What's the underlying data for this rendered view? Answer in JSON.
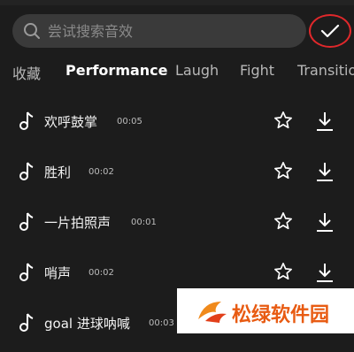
{
  "search": {
    "placeholder": "尝试搜索音效",
    "value": ""
  },
  "tabs": [
    {
      "label": "收藏",
      "active": false
    },
    {
      "label": "Performance",
      "active": true
    },
    {
      "label": "Laugh",
      "active": false
    },
    {
      "label": "Fight",
      "active": false
    },
    {
      "label": "Transition",
      "active": false
    }
  ],
  "sounds": [
    {
      "name": "欢呼鼓掌",
      "duration": "00:05"
    },
    {
      "name": "胜利",
      "duration": "00:02"
    },
    {
      "name": "一片拍照声",
      "duration": "00:01"
    },
    {
      "name": "哨声",
      "duration": "00:02"
    },
    {
      "name": "goal 进球呐喊",
      "duration": "00:03"
    }
  ],
  "watermark": {
    "text": "松绿软件园"
  },
  "colors": {
    "accent_red": "#e0282b",
    "watermark_orange": "#e85b12",
    "background": "#1c1c1c"
  }
}
